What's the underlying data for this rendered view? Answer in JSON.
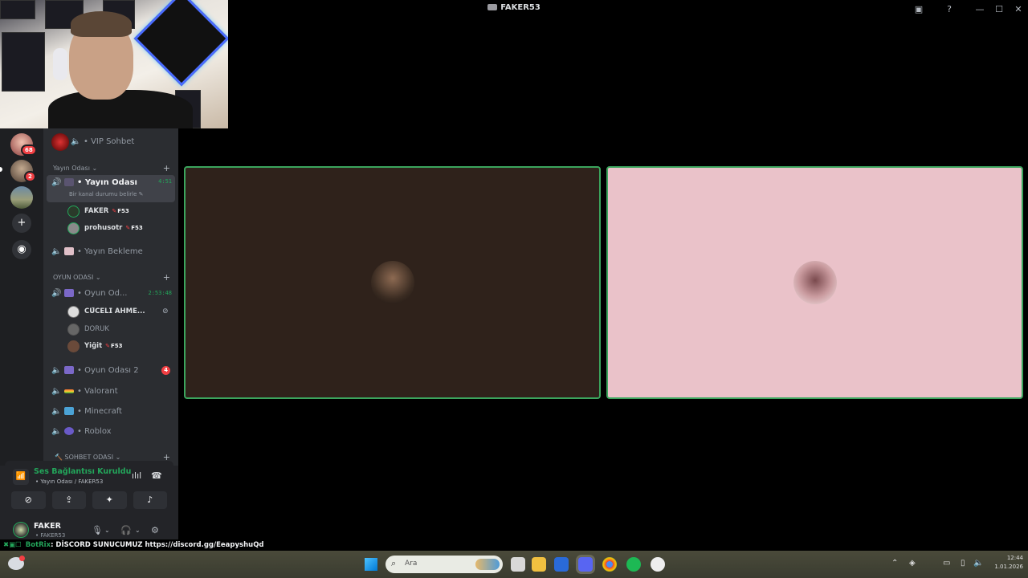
{
  "window": {
    "title": "FAKER53"
  },
  "rail": {
    "servers": [
      {
        "name": "server-avatar-1",
        "badge": "68"
      },
      {
        "name": "server-avatar-2",
        "badge": "2"
      },
      {
        "name": "server-avatar-3"
      }
    ],
    "add_icon": "+",
    "discover_icon": "◉"
  },
  "channels": {
    "top": {
      "label": "• VIP Sohbet"
    },
    "categories": {
      "yayin": "Yayın Odası ⌄",
      "oyun": "OYUN ODASI ⌄",
      "sohbet": "🔨 SOHBET ODASI ⌄"
    },
    "yayin_odasi": {
      "label": "• Yayın Odası",
      "timer": "4:51",
      "status": "Bir kanal durumu belirle ✎"
    },
    "members_yayin": [
      {
        "name": "FAKER",
        "tag": "F53"
      },
      {
        "name": "prohusotr",
        "tag": "F53"
      }
    ],
    "yayin_bekleme": {
      "label": "• Yayın Bekleme"
    },
    "oyun_odasi": {
      "label": "• Oyun Od...",
      "timer": "2:53:48"
    },
    "members_oyun": [
      {
        "name": "𝗖𝗨̈𝗖𝗘𝗟𝗜 𝗔𝗛𝗠𝗘...",
        "muted_icon": "⊘"
      },
      {
        "name": "DORUK"
      },
      {
        "name": "Yiğit",
        "tag": "F53"
      }
    ],
    "oyun_odasi_2": {
      "label": "• Oyun Odası 2",
      "badge": "4"
    },
    "valorant": {
      "label": "• Valorant"
    },
    "minecraft": {
      "label": "• Minecraft"
    },
    "roblox": {
      "label": "• Roblox"
    }
  },
  "voice_panel": {
    "title": "Ses Bağlantısı Kuruldu",
    "subtitle": "• Yayın Odası / FAKER53"
  },
  "user_panel": {
    "name": "FAKER",
    "subtitle": "• FAKER53"
  },
  "ticker": {
    "bot": "BotRix",
    "text": ": DİSCORD SUNUCUMUZ https://discord.gg/EeapyshuQd"
  },
  "taskbar": {
    "search_placeholder": "Ara",
    "clock_time": "12:44",
    "clock_date": "1.01.2026"
  },
  "colors": {
    "speaking_border": "#3ba55d",
    "tile1_bg": "#2f221b",
    "tile2_bg": "#eac2c9",
    "online": "#23a55a",
    "badge": "#f23f43"
  }
}
